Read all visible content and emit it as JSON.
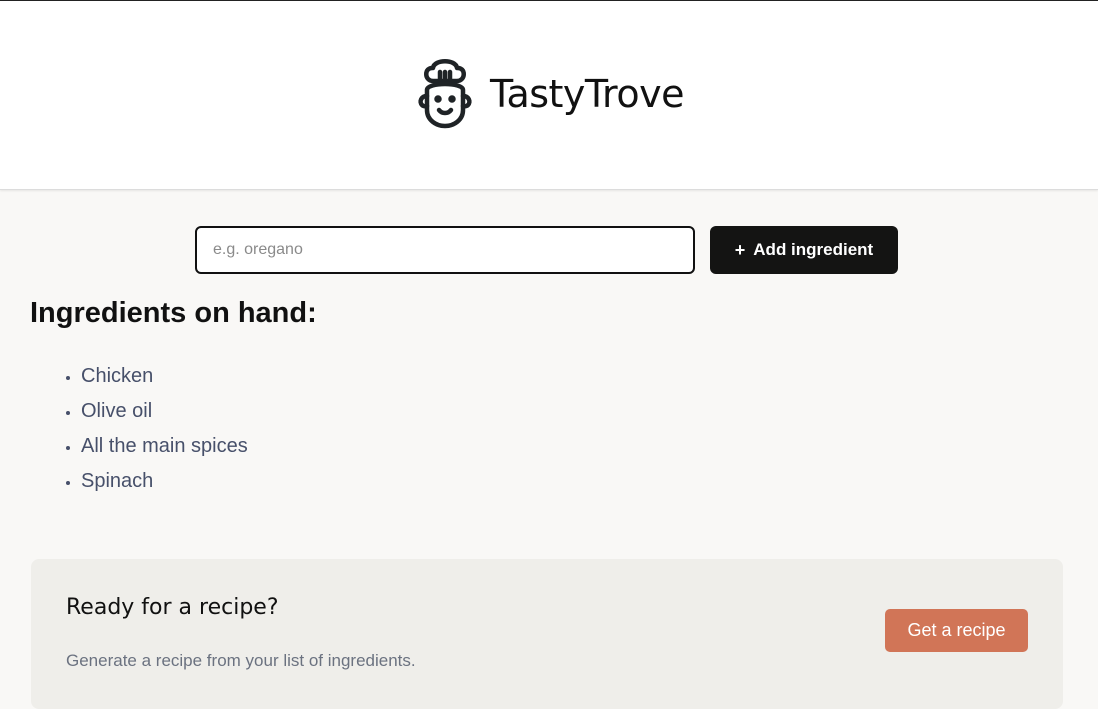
{
  "header": {
    "brand_name": "TastyTrove",
    "logo_icon": "chef-face-icon"
  },
  "form": {
    "placeholder": "e.g. oregano",
    "value": "",
    "add_icon": "+",
    "add_label": "Add ingredient"
  },
  "ingredients": {
    "title": "Ingredients on hand:",
    "items": [
      "Chicken",
      "Olive oil",
      "All the main spices",
      "Spinach"
    ]
  },
  "recipe_cta": {
    "heading": "Ready for a recipe?",
    "description": "Generate a recipe from your list of ingredients.",
    "button_label": "Get a recipe"
  },
  "colors": {
    "accent": "#d17557",
    "primary_button": "#141413",
    "card_background": "#efeeea",
    "page_background": "#f9f8f6"
  }
}
